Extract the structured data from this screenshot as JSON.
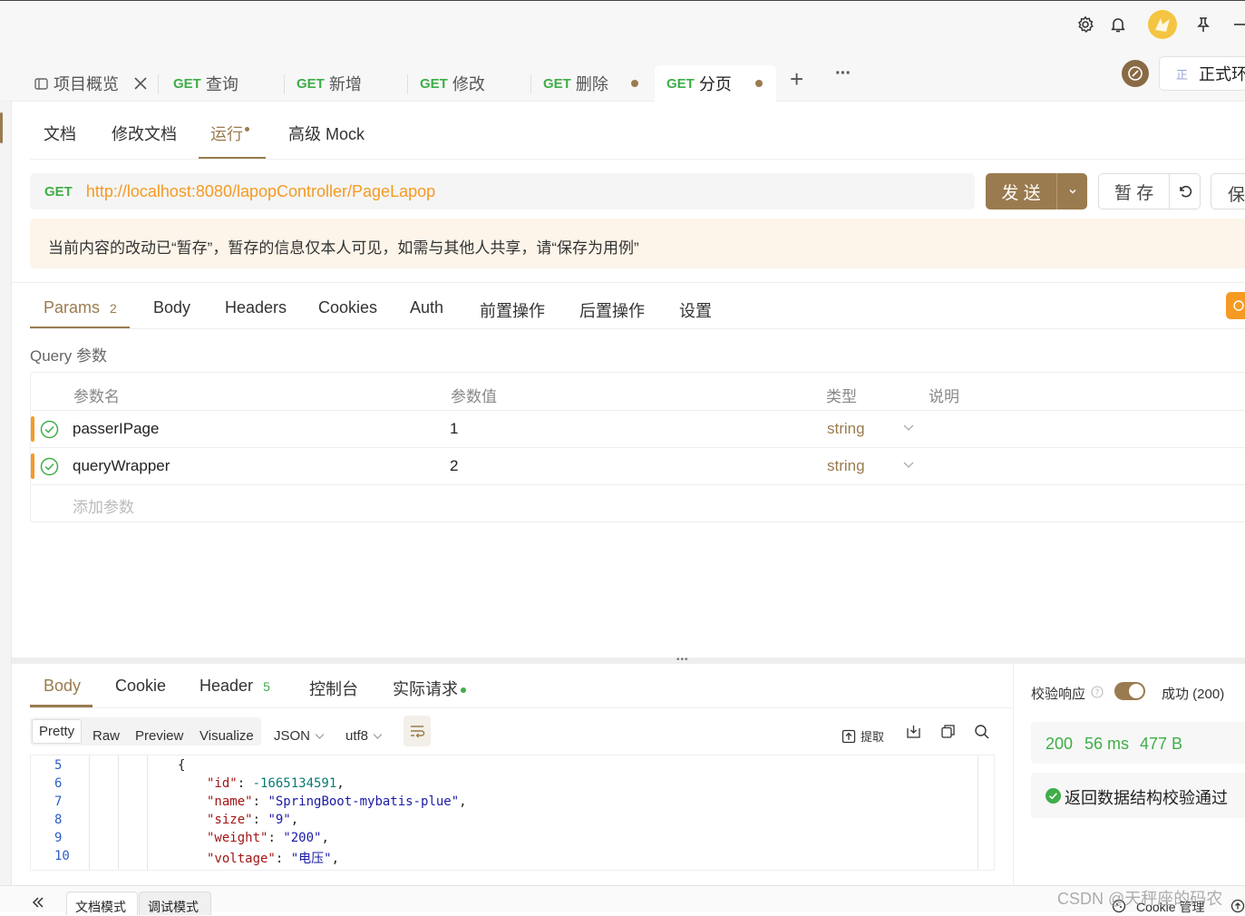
{
  "colors": {
    "accent": "#9a7b4f",
    "method_get": "#3fae48",
    "url": "#f59a23",
    "success": "#3fae48",
    "notice_bg": "#fdf5ea"
  },
  "topbar": {
    "icons": [
      "settings-icon",
      "bell-icon",
      "avatar",
      "pin-icon",
      "minimize-icon"
    ]
  },
  "tabs": [
    {
      "method": "",
      "label": "项目概览",
      "closable": true
    },
    {
      "method": "GET",
      "label": "查询"
    },
    {
      "method": "GET",
      "label": "新增"
    },
    {
      "method": "GET",
      "label": "修改"
    },
    {
      "method": "GET",
      "label": "删除",
      "modified": true
    },
    {
      "method": "GET",
      "label": "分页",
      "modified": true,
      "active": true
    }
  ],
  "tab_actions": {
    "add": "+",
    "more": "···"
  },
  "env": {
    "badge": "正",
    "label": "正式环"
  },
  "subtabs": {
    "doc": "文档",
    "edit_doc": "修改文档",
    "run": "运行",
    "mock": "高级 Mock"
  },
  "request": {
    "method": "GET",
    "url": "http://localhost:8080/lapopController/PageLapop",
    "send_label": "发 送",
    "temp_save_label": "暂 存",
    "save_label": "保"
  },
  "notice": "当前内容的改动已“暂存”，暂存的信息仅本人可见，如需与其他人共享，请“保存为用例”",
  "param_tabs": {
    "params": "Params",
    "params_count": "2",
    "body": "Body",
    "headers": "Headers",
    "cookies": "Cookies",
    "auth": "Auth",
    "pre": "前置操作",
    "post": "后置操作",
    "settings": "设置"
  },
  "query": {
    "title": "Query 参数",
    "headers": {
      "name": "参数名",
      "value": "参数值",
      "type": "类型",
      "desc": "说明"
    },
    "rows": [
      {
        "name": "passerIPage",
        "value": "1",
        "type": "string"
      },
      {
        "name": "queryWrapper",
        "value": "2",
        "type": "string"
      }
    ],
    "add_placeholder": "添加参数"
  },
  "response": {
    "tabs": {
      "body": "Body",
      "cookie": "Cookie",
      "header": "Header",
      "header_count": "5",
      "console": "控制台",
      "actual": "实际请求"
    },
    "formats": {
      "pretty": "Pretty",
      "raw": "Raw",
      "preview": "Preview",
      "visualize": "Visualize",
      "json": "JSON",
      "encoding": "utf8"
    },
    "tools": {
      "extract": "提取"
    },
    "code": {
      "line_numbers": [
        "5",
        "6",
        "7",
        "8",
        "9",
        "10"
      ],
      "open_brace": "{",
      "lines": [
        {
          "key": "\"id\"",
          "value": "-1665134591",
          "kind": "number"
        },
        {
          "key": "\"name\"",
          "value": "\"SpringBoot-mybatis-plue\"",
          "kind": "string"
        },
        {
          "key": "\"size\"",
          "value": "\"9\"",
          "kind": "string"
        },
        {
          "key": "\"weight\"",
          "value": "\"200\"",
          "kind": "string"
        },
        {
          "key": "\"voltage\"",
          "value": "\"电压\"",
          "kind": "string"
        }
      ]
    }
  },
  "validation": {
    "label": "校验响应",
    "enabled": true,
    "result": "成功 (200)",
    "status": "200",
    "time": "56 ms",
    "size": "477 B",
    "message": "返回数据结构校验通过"
  },
  "footer": {
    "doc_mode": "文档模式",
    "debug_mode": "调试模式",
    "cookie": "Cookie 管理",
    "watermark": "CSDN @天秤座的码农"
  }
}
